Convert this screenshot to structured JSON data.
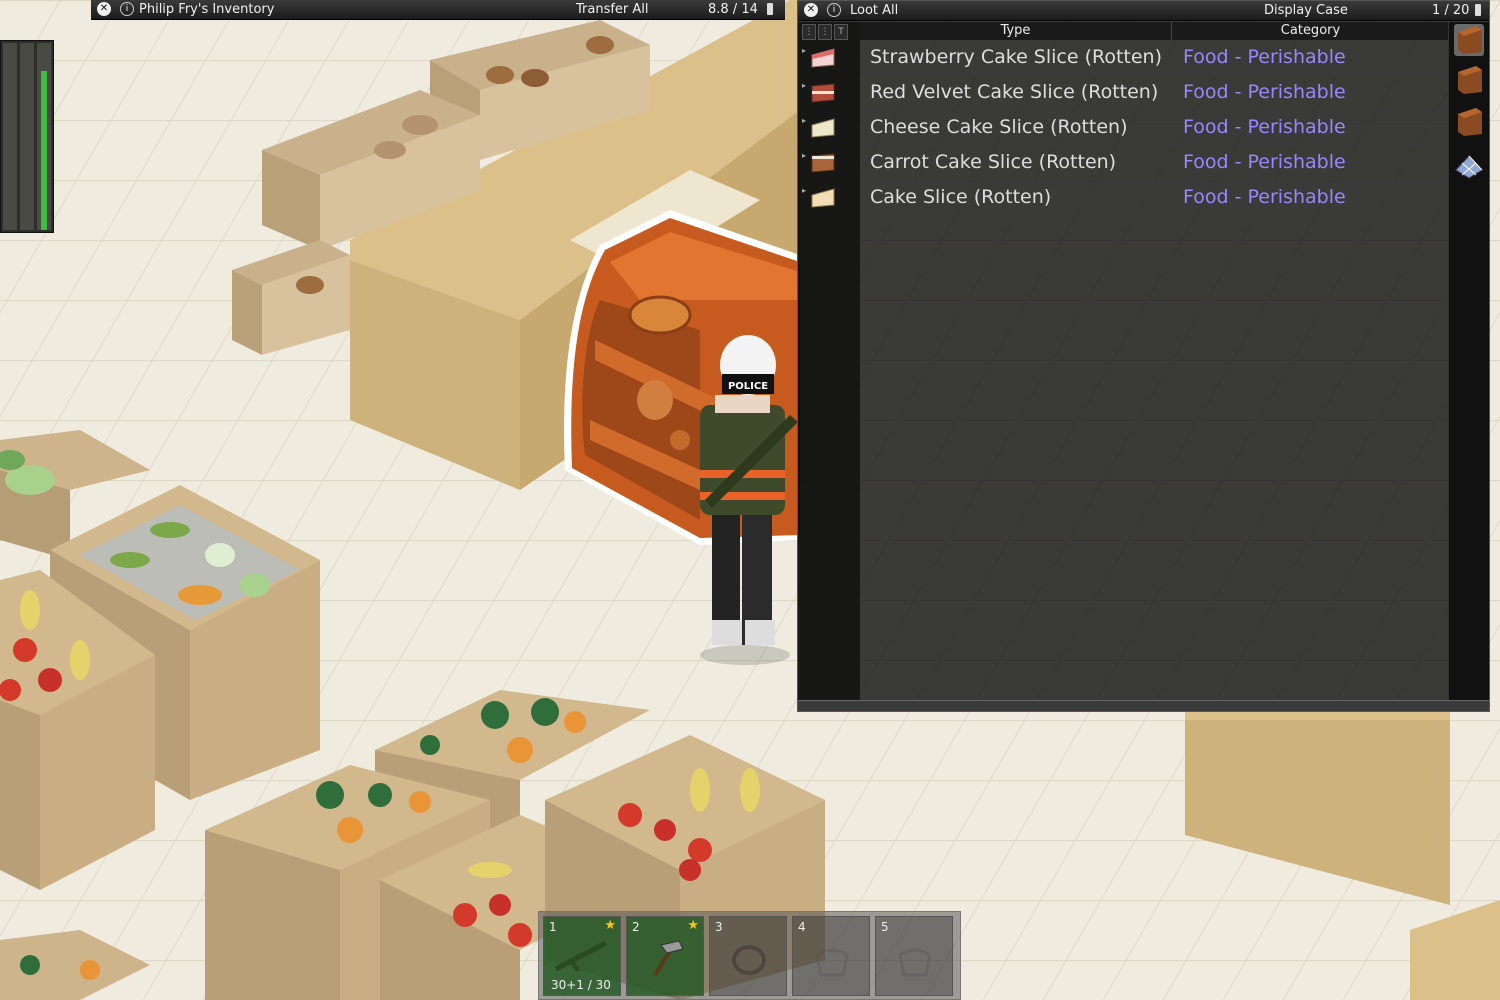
{
  "inventory": {
    "title": "Philip Fry's Inventory",
    "transfer_all": "Transfer All",
    "weight": "8.8 / 14"
  },
  "loot": {
    "loot_all": "Loot All",
    "container": "Display Case",
    "weight": "1 / 20",
    "col_type": "Type",
    "col_category": "Category",
    "items": [
      {
        "name": "Strawberry Cake Slice (Rotten)",
        "category": "Food - Perishable",
        "icon": "strawberry-cake-icon",
        "color": "#f3d3d3"
      },
      {
        "name": "Red Velvet Cake Slice (Rotten)",
        "category": "Food - Perishable",
        "icon": "red-velvet-cake-icon",
        "color": "#b34a3a"
      },
      {
        "name": "Cheese Cake Slice (Rotten)",
        "category": "Food - Perishable",
        "icon": "cheese-cake-icon",
        "color": "#efe8c8"
      },
      {
        "name": "Carrot Cake Slice (Rotten)",
        "category": "Food - Perishable",
        "icon": "carrot-cake-icon",
        "color": "#a9653a"
      },
      {
        "name": "Cake Slice (Rotten)",
        "category": "Food - Perishable",
        "icon": "cake-slice-icon",
        "color": "#f1dfb3"
      }
    ]
  },
  "hotbar": {
    "slots": [
      {
        "num": "1",
        "count": "30+1 / 30",
        "starred": true,
        "icon": "rifle-icon"
      },
      {
        "num": "2",
        "starred": true,
        "icon": "hammer-icon"
      },
      {
        "num": "3",
        "icon": "empty-slot-icon"
      },
      {
        "num": "4",
        "icon": "empty-slot-icon"
      },
      {
        "num": "5",
        "icon": "empty-slot-icon"
      }
    ]
  },
  "colors": {
    "category_text": "#9a86ff",
    "item_text": "#dddddd",
    "status_green": "#3fbf3f"
  }
}
